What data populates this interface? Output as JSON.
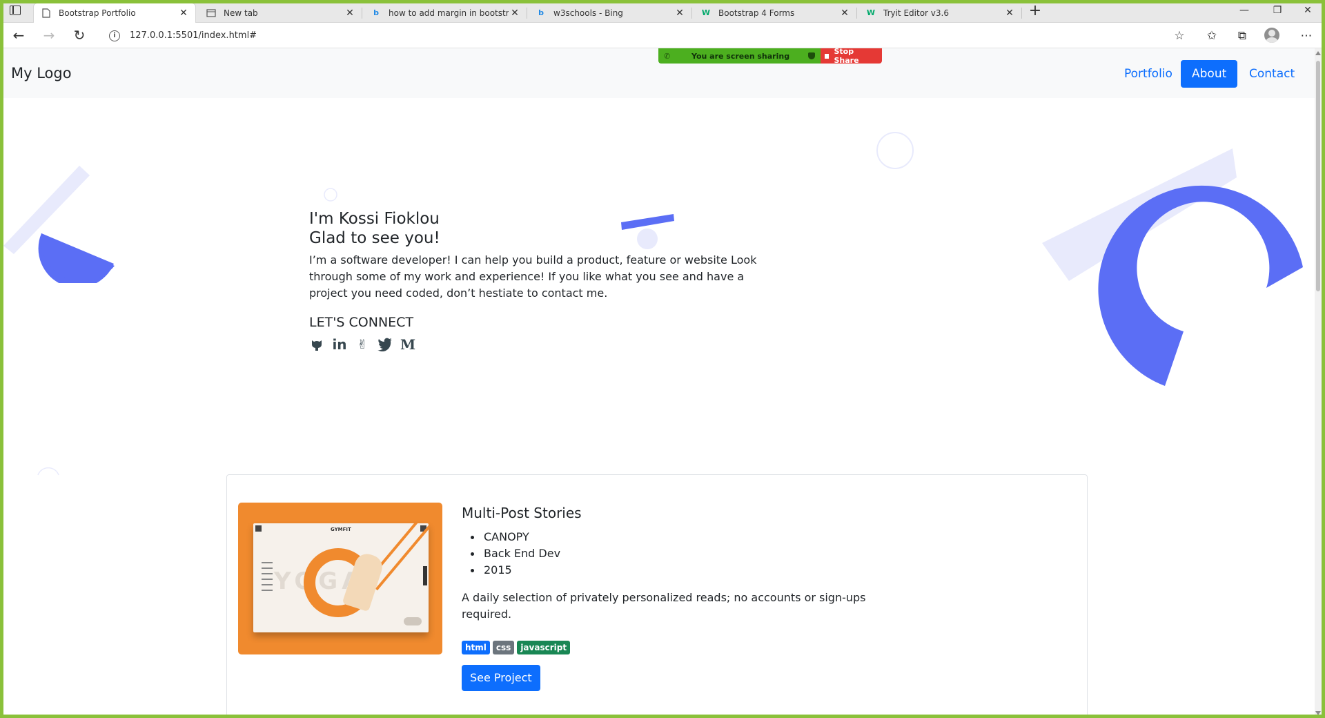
{
  "browser": {
    "tabs": [
      {
        "title": "Bootstrap Portfolio",
        "favicon": "page-icon",
        "active": true
      },
      {
        "title": "New tab",
        "favicon": "newtab-icon",
        "active": false
      },
      {
        "title": "how to add margin in bootstrap",
        "favicon": "bing-icon",
        "active": false
      },
      {
        "title": "w3schools - Bing",
        "favicon": "bing-icon",
        "active": false
      },
      {
        "title": "Bootstrap 4 Forms",
        "favicon": "w3schools-icon",
        "active": false
      },
      {
        "title": "Tryit Editor v3.6",
        "favicon": "w3schools-icon",
        "active": false
      }
    ],
    "new_tab": "+",
    "window_buttons": {
      "minimize": "—",
      "restore": "❐",
      "close": "✕"
    },
    "address": "127.0.0.1:5501/index.html#"
  },
  "screen_share": {
    "message": "You are screen sharing",
    "stop_label": "Stop Share",
    "colors": {
      "share": "#4caf1f",
      "stop": "#e53935"
    }
  },
  "navbar": {
    "logo": "My Logo",
    "links": [
      {
        "label": "Portfolio",
        "active": false
      },
      {
        "label": "About",
        "active": true
      },
      {
        "label": "Contact",
        "active": false
      }
    ]
  },
  "hero": {
    "line1": "I'm Kossi Fioklou",
    "line2": "Glad to see you!",
    "text": "I’m a software developer! I can help you build a product, feature or website Look through some of my work and experience! If you like what you see and have a project you need coded, don’t hestiate to contact me.",
    "connect_heading": "LET'S CONNECT",
    "socials": [
      {
        "name": "github-icon",
        "glyph": "🐙"
      },
      {
        "name": "linkedin-icon",
        "glyph": "in"
      },
      {
        "name": "angellist-icon",
        "glyph": "✌"
      },
      {
        "name": "twitter-icon",
        "glyph": "🐦"
      },
      {
        "name": "medium-icon",
        "glyph": "M"
      }
    ]
  },
  "project": {
    "title": "Multi-Post Stories",
    "details": [
      "CANOPY",
      "Back End Dev",
      "2015"
    ],
    "description": "A daily selection of privately personalized reads; no accounts or sign-ups required.",
    "thumbnail_brand": "GYMFIT",
    "thumbnail_word": "YOGA",
    "badges": [
      {
        "label": "html",
        "color": "#0d6efd"
      },
      {
        "label": "css",
        "color": "#6c757d"
      },
      {
        "label": "javascript",
        "color": "#198754"
      }
    ],
    "button": "See Project"
  },
  "colors": {
    "accent": "#0d6efd",
    "shape_blue": "#5b6ef5",
    "shape_light": "#e8eafc",
    "thumb_orange": "#f08a2e"
  }
}
